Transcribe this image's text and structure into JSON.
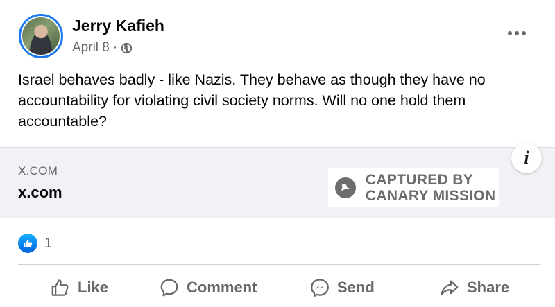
{
  "post": {
    "author": "Jerry Kafieh",
    "date": "April 8",
    "separator": "·",
    "text": "Israel behaves badly - like Nazis.  They behave as though they have no accountability for violating civil society norms.  Will no one hold them accountable?",
    "audience_icon": "globe-icon"
  },
  "link_card": {
    "domain": "X.COM",
    "title": "x.com",
    "info_label": "i"
  },
  "watermark": {
    "line1": "CAPTURED BY",
    "line2": "CANARY MISSION"
  },
  "reactions": {
    "count": "1",
    "icon": "thumbs-up-icon"
  },
  "actions": {
    "like": "Like",
    "comment": "Comment",
    "send": "Send",
    "share": "Share"
  },
  "colors": {
    "accent": "#1877f2",
    "secondary_text": "#65676b",
    "card_bg": "#f0f2f5"
  }
}
